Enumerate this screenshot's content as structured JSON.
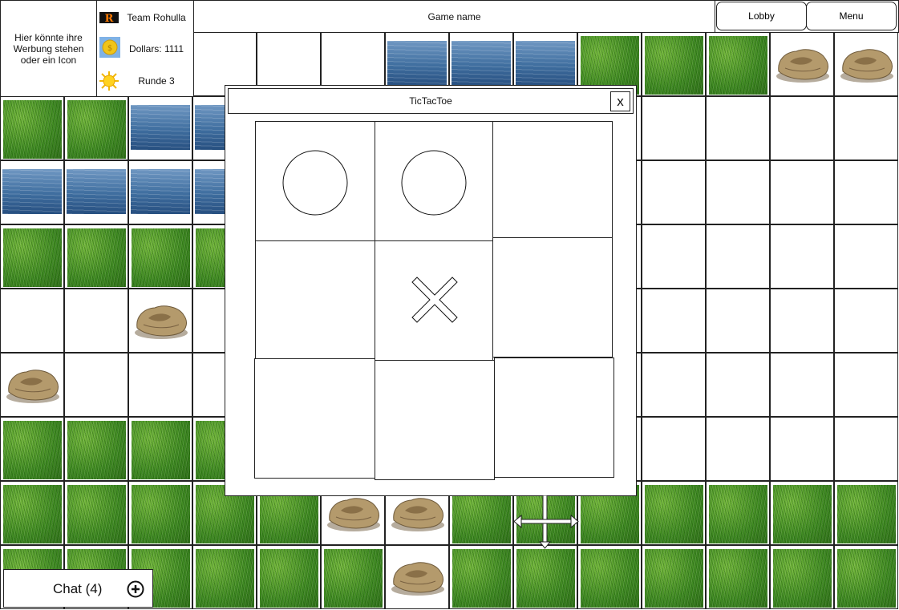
{
  "header": {
    "ad_text": "Hier könnte ihre Werbung stehen oder ein Icon",
    "team_name": "Team Rohulla",
    "team_icon_letter": "R",
    "dollars": "Dollars: 1111",
    "round": "Runde 3",
    "game_name": "Game name",
    "lobby_label": "Lobby",
    "menu_label": "Menu"
  },
  "dialog": {
    "title": "TicTacToe",
    "close_label": "x",
    "board": [
      "O",
      "O",
      "",
      "",
      "X",
      "",
      "",
      "",
      ""
    ]
  },
  "chat": {
    "label": "Chat (4)",
    "add_icon": "plus-circle-icon"
  },
  "map": {
    "legend": {
      "G": "grass",
      "W": "water",
      "R": "rock",
      ".": "empty"
    },
    "rows": [
      "......WWWGGGRR",
      "GGWW..........",
      "WWWW..........",
      "GGGG..........",
      "..R...........",
      "R.............",
      "GGGG..........",
      "GGGGGRRGGGGGGG",
      "GGGGGGRGGGGGGG"
    ]
  },
  "colors": {
    "grass": "#4f9a2a",
    "water": "#3f6e9f",
    "rock": "#a88f65",
    "border": "#222222",
    "coin": "#f0c419",
    "coin_bg": "#7fb2e6",
    "team_logo_bg": "#111111",
    "team_logo_fg": "#ff7a00"
  }
}
